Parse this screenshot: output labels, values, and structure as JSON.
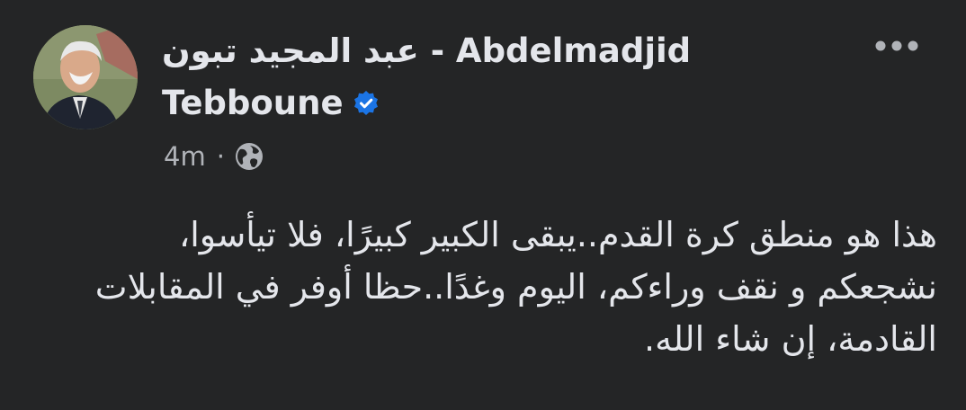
{
  "post": {
    "author": {
      "name_line_1": "عبد المجيد تبون - Abdelmadjid",
      "name_line_2": "Tebboune",
      "verified": true,
      "avatar_icon": "profile-photo"
    },
    "timestamp": "4m",
    "separator": "·",
    "audience_icon": "globe-icon",
    "more_icon": "more-options-icon",
    "body_lines": [
      "هذا هو منطق كرة القدم..يبقى الكبير كبيرًا، فلا تيأسوا،",
      "نشجعكم و نقف وراءكم، اليوم وغدًا..حظا أوفر في المقابلات",
      "القادمة، إن شاء الله."
    ]
  },
  "colors": {
    "background": "#242526",
    "primary_text": "#e4e6eb",
    "secondary_text": "#b0b3b8",
    "verified_badge": "#1b74e4"
  }
}
